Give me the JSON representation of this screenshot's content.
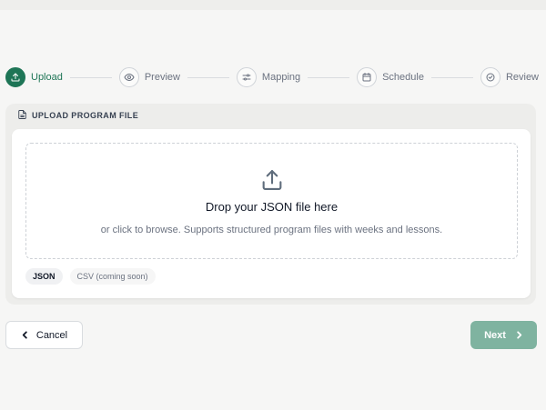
{
  "stepper": {
    "steps": [
      {
        "label": "Upload",
        "icon": "upload-icon",
        "active": true
      },
      {
        "label": "Preview",
        "icon": "eye-icon",
        "active": false
      },
      {
        "label": "Mapping",
        "icon": "sliders-icon",
        "active": false
      },
      {
        "label": "Schedule",
        "icon": "calendar-icon",
        "active": false
      },
      {
        "label": "Review",
        "icon": "check-circle-icon",
        "active": false
      }
    ]
  },
  "card": {
    "title": "UPLOAD PROGRAM FILE",
    "title_icon": "file-icon",
    "dropzone": {
      "icon": "upload-icon",
      "title": "Drop your JSON file here",
      "subtitle": "or click to browse. Supports structured program files with weeks and lessons."
    },
    "formats": [
      {
        "label": "JSON",
        "enabled": true
      },
      {
        "label": "CSV (coming soon)",
        "enabled": false
      }
    ]
  },
  "footer": {
    "cancel_label": "Cancel",
    "next_label": "Next"
  },
  "colors": {
    "accent": "#1e7556",
    "next_button": "#7fb3a0",
    "background": "#f6f6f5"
  }
}
